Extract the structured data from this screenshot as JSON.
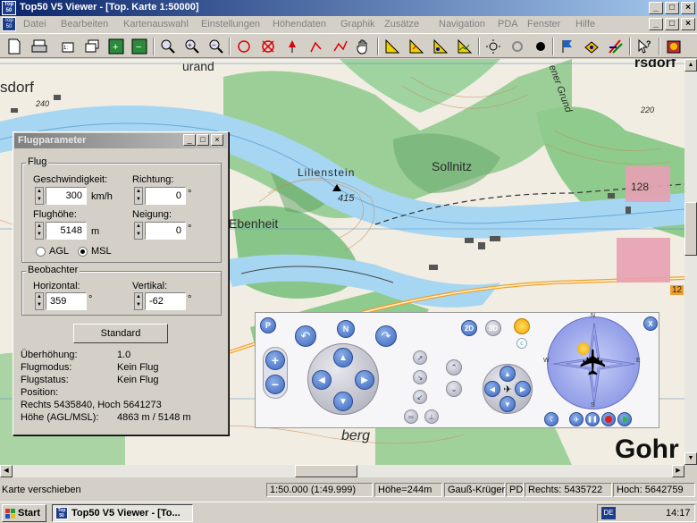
{
  "window": {
    "title": "Top50 V5 Viewer - [Top. Karte 1:50000]",
    "app_icon_text": "Top 50"
  },
  "menu": [
    {
      "label": "Datei"
    },
    {
      "label": "Bearbeiten"
    },
    {
      "label": "Kartenauswahl"
    },
    {
      "label": "Einstellungen"
    },
    {
      "label": "Höhendaten"
    },
    {
      "label": "Graphik"
    },
    {
      "label": "Zusätze"
    },
    {
      "label": "Navigation"
    },
    {
      "label": "PDA"
    },
    {
      "label": "Fenster"
    },
    {
      "label": "Hilfe"
    }
  ],
  "map": {
    "labels": {
      "dorf": "sdorf",
      "ebenheit": "Ebenheit",
      "lilienstein": "Lilienstein",
      "lilienstein_height": "415",
      "sollnitz": "Sollnitz",
      "berg": "berg",
      "gohr": "Gohr",
      "grund": "ener Grund",
      "n240": "240",
      "n220": "220",
      "n128": "128",
      "n12": "12",
      "urand": "urand",
      "teuchau": "rsdorf"
    }
  },
  "flug_dialog": {
    "title": "Flugparameter",
    "group_flug": "Flug",
    "speed_label": "Geschwindigkeit:",
    "speed_value": "300",
    "speed_unit": "km/h",
    "direction_label": "Richtung:",
    "direction_value": "0",
    "direction_unit": "°",
    "height_label": "Flughöhe:",
    "height_value": "5148",
    "height_unit": "m",
    "tilt_label": "Neigung:",
    "tilt_value": "0",
    "tilt_unit": "°",
    "radio_agl": "AGL",
    "radio_msl": "MSL",
    "radio_selected": "MSL",
    "group_observer": "Beobachter",
    "horizontal_label": "Horizontal:",
    "horizontal_value": "359",
    "horizontal_unit": "°",
    "vertical_label": "Vertikal:",
    "vertical_value": "-62",
    "vertical_unit": "°",
    "standard_button": "Standard",
    "info": [
      {
        "label": "Überhöhung:",
        "value": "1.0"
      },
      {
        "label": "Flugmodus:",
        "value": "Kein Flug"
      },
      {
        "label": "Flugstatus:",
        "value": "Kein Flug"
      },
      {
        "label": "Position:",
        "value": ""
      }
    ],
    "position_value": "Rechts 5435840, Hoch 5641273",
    "height_line_label": "Höhe (AGL/MSL):",
    "height_line_value": "4863 m / 5148 m"
  },
  "nav_panel": {
    "p_label": "P",
    "n_label": "N",
    "view_2d": "2D",
    "view_3d": "3D",
    "close_label": "X",
    "compass": {
      "n": "N",
      "s": "S",
      "w": "W",
      "e": "E"
    }
  },
  "status": {
    "message": "Karte verschieben",
    "scale": "1:50.000  (1:49.999)",
    "hoehe": "Höhe=244m",
    "projection": "Gauß-Krüger",
    "pd": "PD",
    "rechts": "Rechts: 5435722",
    "hoch": "Hoch: 5642759"
  },
  "taskbar": {
    "start": "Start",
    "task": "Top50 V5 Viewer - [To...",
    "lang": "DE",
    "clock": "14:17"
  },
  "colors": {
    "titlebar": "#0a246a",
    "river": "#9fd0f0",
    "forest": "#7cc07e",
    "road": "#f0a030",
    "contour": "#c48a5a"
  }
}
